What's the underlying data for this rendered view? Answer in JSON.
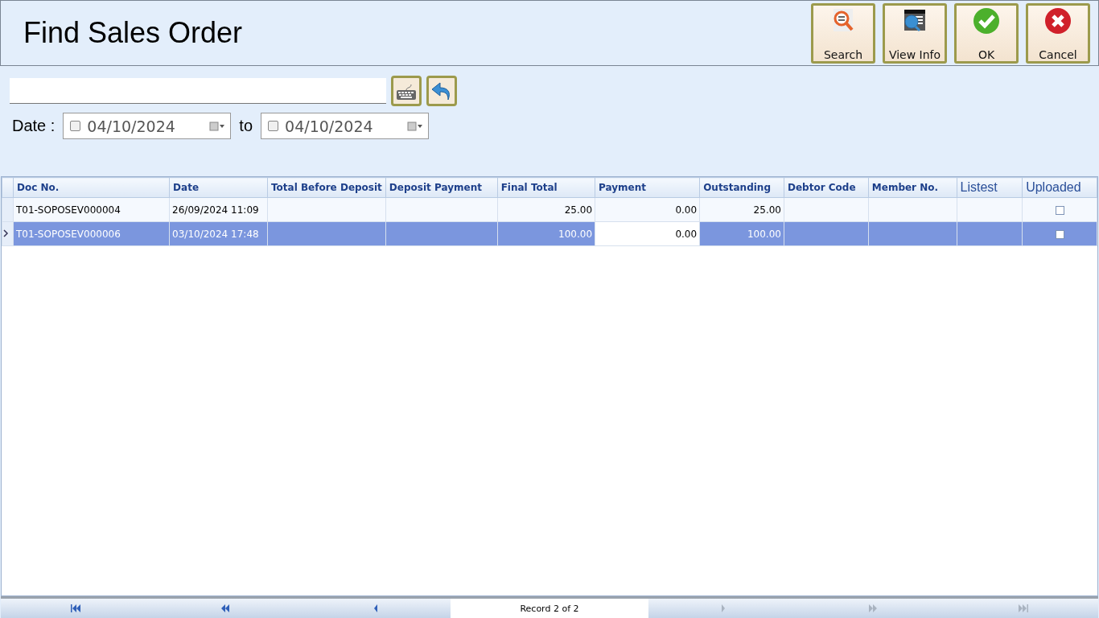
{
  "title": "Find Sales Order",
  "toolbar": [
    {
      "kind": "search",
      "label": "Search"
    },
    {
      "kind": "info",
      "label": "View Info"
    },
    {
      "kind": "ok",
      "label": "OK"
    },
    {
      "kind": "cancel",
      "label": "Cancel"
    }
  ],
  "date_filter": {
    "label": "Date :",
    "separator": "to",
    "from": {
      "checked": false,
      "value": "04/10/2024"
    },
    "to": {
      "checked": false,
      "value": "04/10/2024"
    }
  },
  "table": {
    "columns": [
      {
        "kind": "text",
        "label": "Doc No.",
        "plain": false
      },
      {
        "kind": "text",
        "label": "Date",
        "plain": false
      },
      {
        "kind": "text",
        "label": "Total Before Deposit",
        "plain": false
      },
      {
        "kind": "text",
        "label": "Deposit Payment",
        "plain": false
      },
      {
        "kind": "number",
        "label": "Final Total",
        "plain": false
      },
      {
        "kind": "number",
        "label": "Payment",
        "plain": false
      },
      {
        "kind": "number",
        "label": "Outstanding",
        "plain": false
      },
      {
        "kind": "text",
        "label": "Debtor Code",
        "plain": false
      },
      {
        "kind": "text",
        "label": "Member No.",
        "plain": false
      },
      {
        "kind": "text",
        "label": "Listest",
        "plain": true
      },
      {
        "kind": "check",
        "label": "Uploaded",
        "plain": true
      }
    ],
    "rows": [
      {
        "selected": false,
        "cells": [
          "T01-SOPOSEV000004",
          "26/09/2024 11:09",
          null,
          null,
          "25.00",
          {
            "text": "0.00",
            "focused": false
          },
          "25.00",
          null,
          null,
          null
        ],
        "uploaded": false
      },
      {
        "selected": true,
        "cells": [
          "T01-SOPOSEV000006",
          "03/10/2024 17:48",
          null,
          null,
          "100.00",
          {
            "text": "0.00",
            "focused": true
          },
          "100.00",
          null,
          null,
          null
        ],
        "uploaded": false
      }
    ]
  },
  "navigator": {
    "record": "Record 2 of 2",
    "buttons": [
      {
        "kind": "first",
        "disabled": false
      },
      {
        "kind": "prev_page",
        "disabled": false
      },
      {
        "kind": "prev",
        "disabled": false
      },
      {
        "kind": "next",
        "disabled": true
      },
      {
        "kind": "next_page",
        "disabled": true
      },
      {
        "kind": "last",
        "disabled": true
      }
    ]
  }
}
